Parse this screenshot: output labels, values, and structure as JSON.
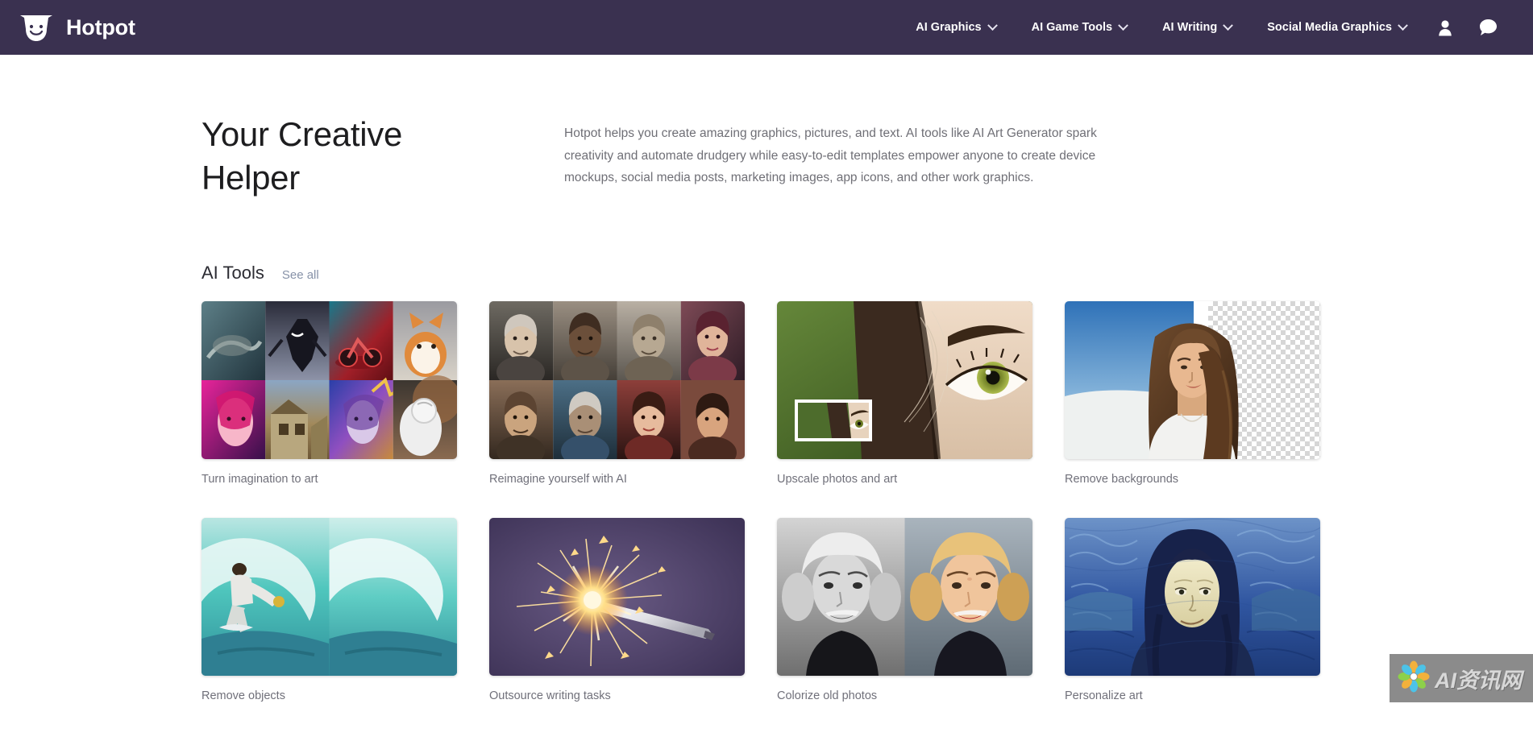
{
  "header": {
    "brand_name": "Hotpot",
    "logo_icon": "hotpot-smiling-pot-icon",
    "nav_items": [
      {
        "label": "AI Graphics",
        "icon": "chevron-down-icon"
      },
      {
        "label": "AI Game Tools",
        "icon": "chevron-down-icon"
      },
      {
        "label": "AI Writing",
        "icon": "chevron-down-icon"
      },
      {
        "label": "Social Media Graphics",
        "icon": "chevron-down-icon"
      }
    ],
    "account_icon": "user-account-icon",
    "chat_icon": "chat-bubble-icon",
    "background_color": "#3a3150"
  },
  "hero": {
    "title": "Your Creative Helper",
    "description": "Hotpot helps you create amazing graphics, pictures, and text. AI tools like AI Art Generator spark creativity and automate drudgery while easy-to-edit templates empower anyone to create device mockups, social media posts, marketing images, app icons, and other work graphics."
  },
  "ai_tools_section": {
    "title": "AI Tools",
    "see_all_label": "See all",
    "see_all_color": "#8792a8",
    "cards": [
      {
        "label": "Turn imagination to art",
        "thumb": "ai-art-grid-thumbnail"
      },
      {
        "label": "Reimagine yourself with AI",
        "thumb": "ai-portrait-grid-thumbnail"
      },
      {
        "label": "Upscale photos and art",
        "thumb": "eye-upscale-thumbnail"
      },
      {
        "label": "Remove backgrounds",
        "thumb": "background-removal-thumbnail"
      },
      {
        "label": "Remove objects",
        "thumb": "surfer-wave-removal-thumbnail"
      },
      {
        "label": "Outsource writing tasks",
        "thumb": "sparkler-pen-thumbnail"
      },
      {
        "label": "Colorize old photos",
        "thumb": "colorize-portrait-thumbnail"
      },
      {
        "label": "Personalize art",
        "thumb": "mona-lisa-style-thumbnail"
      }
    ]
  },
  "watermark": {
    "text": "AI资讯网",
    "icon": "pinwheel-flower-icon",
    "background_color": "#8b8b8b"
  }
}
